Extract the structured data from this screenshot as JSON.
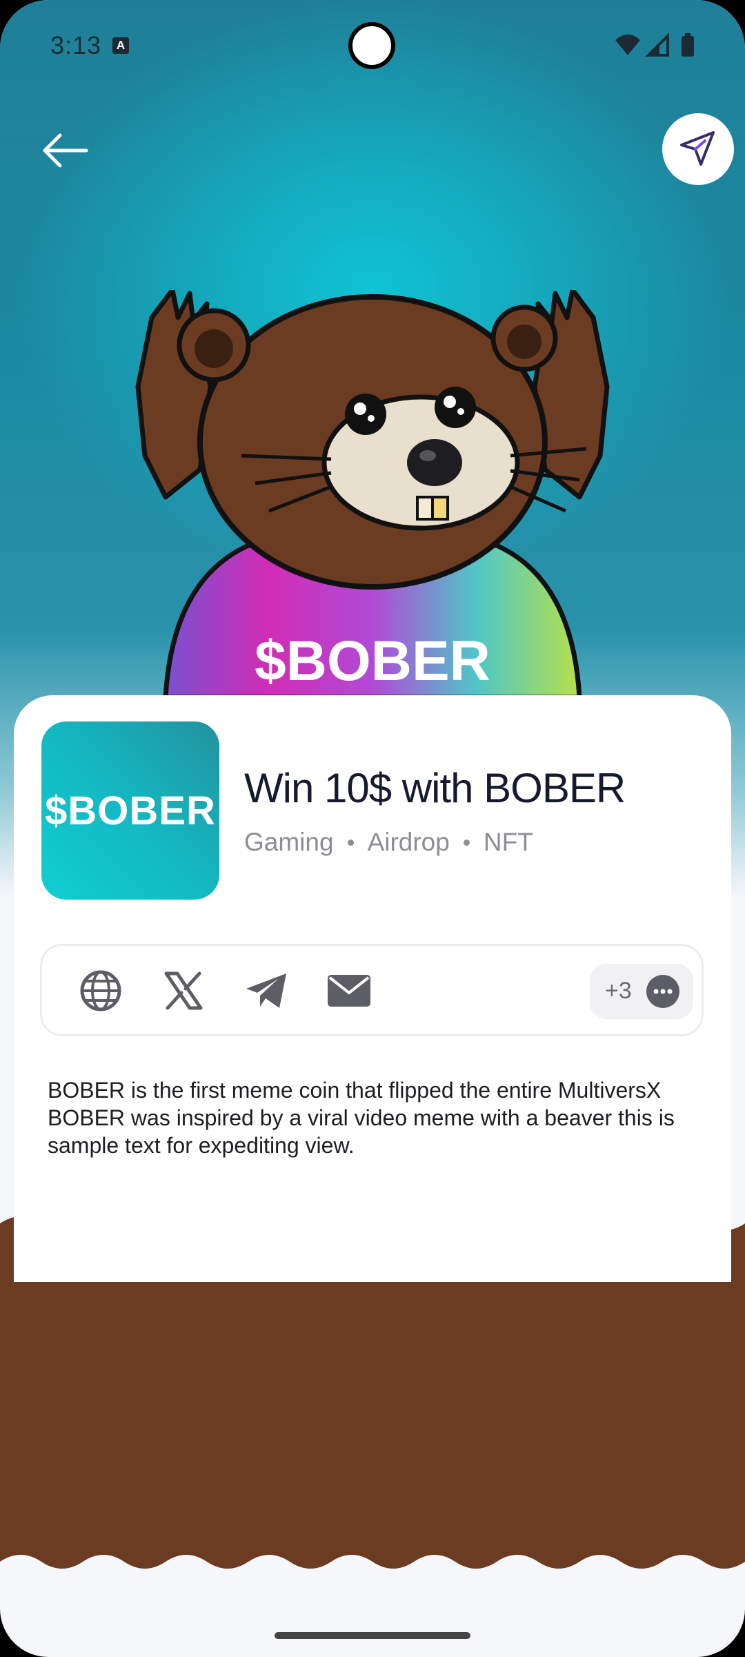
{
  "status_bar": {
    "time": "3:13",
    "notification_icon_letter": "A",
    "icons": [
      "wifi-icon",
      "cellular-icon",
      "battery-icon"
    ]
  },
  "header": {
    "back_icon": "arrow-left-icon",
    "share_icon": "paper-plane-icon"
  },
  "hero": {
    "shirt_text": "$BOBER"
  },
  "project": {
    "logo_text": "$BOBER",
    "title": "Win 10$ with BOBER",
    "tags": [
      "Gaming",
      "Airdrop",
      "NFT"
    ]
  },
  "links": {
    "icons": [
      "globe-icon",
      "x-icon",
      "telegram-icon",
      "mail-icon"
    ],
    "more_count": "+3",
    "more_icon": "ellipsis-icon"
  },
  "description": "BOBER is the first meme coin that flipped the entire MultiversX BOBER was inspired by a viral video meme with a beaver this is sample text for expediting view.",
  "colors": {
    "hero_teal": "#1b8aa2",
    "brown": "#6b3c22",
    "card": "#ffffff",
    "share_accent": "#7b4dd8"
  }
}
